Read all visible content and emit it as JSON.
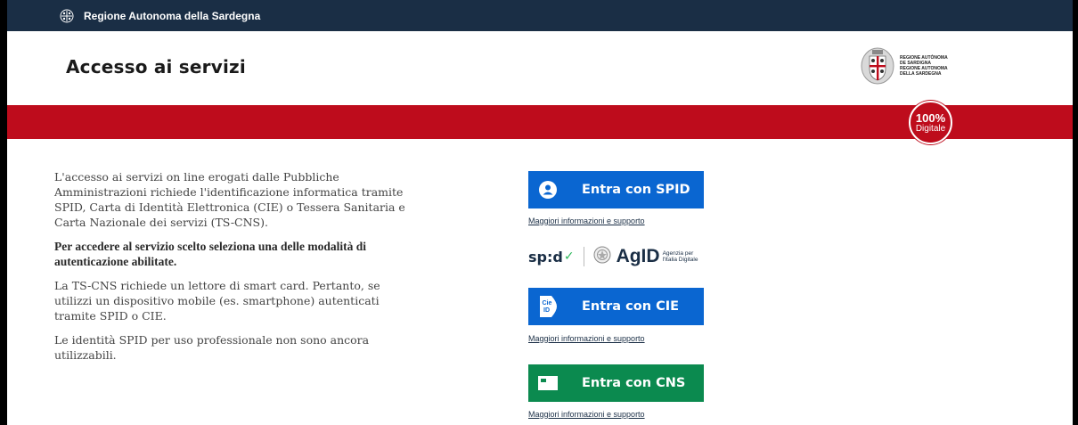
{
  "topbar": {
    "logo_icon": "sardinia-emblem-icon",
    "title": "Regione Autonoma della Sardegna",
    "bg_color": "#1a2e45"
  },
  "header": {
    "title": "Accesso ai servizi",
    "region_logo_lines": [
      "REGIONE AUTÒNOMA",
      "DE SARDIGNA",
      "REGIONE AUTONOMA",
      "DELLA SARDEGNA"
    ]
  },
  "band": {
    "color": "#be0c1c",
    "badge_pct": "100%",
    "badge_label": "Digitale"
  },
  "intro": {
    "p1": "L'accesso ai servizi on line erogati dalle Pubbliche Amministrazioni richiede l'identificazione informatica tramite SPID, Carta di Identità Elettronica (CIE) o Tessera Sanitaria e Carta Nazionale dei servizi (TS-CNS).",
    "p2": "Per accedere al servizio scelto seleziona una delle modalità di autenticazione abilitate.",
    "p3": "La TS-CNS richiede un lettore di smart card. Pertanto, se utilizzi un dispositivo mobile (es. smartphone) autenticati tramite SPID o CIE.",
    "p4": "Le identità SPID per uso professionale non sono ancora utilizzabili."
  },
  "login": {
    "spid": {
      "label": "Entra con SPID",
      "icon": "user-icon",
      "color": "#0a66d1",
      "help": "Maggiori informazioni e supporto"
    },
    "spid_logos": {
      "spid_word": "sp:d",
      "agid_word": "AgID",
      "agid_sub_1": "Agenzia per",
      "agid_sub_2": "l'Italia Digitale"
    },
    "cie": {
      "label": "Entra con CIE",
      "icon": "cie-id-icon",
      "icon_text_1": "Cie",
      "icon_text_2": "ID",
      "color": "#0a66d1",
      "help": "Maggiori informazioni e supporto"
    },
    "cns": {
      "label": "Entra con CNS",
      "icon": "card-icon",
      "color": "#0b8a4f",
      "help": "Maggiori informazioni e supporto"
    }
  }
}
